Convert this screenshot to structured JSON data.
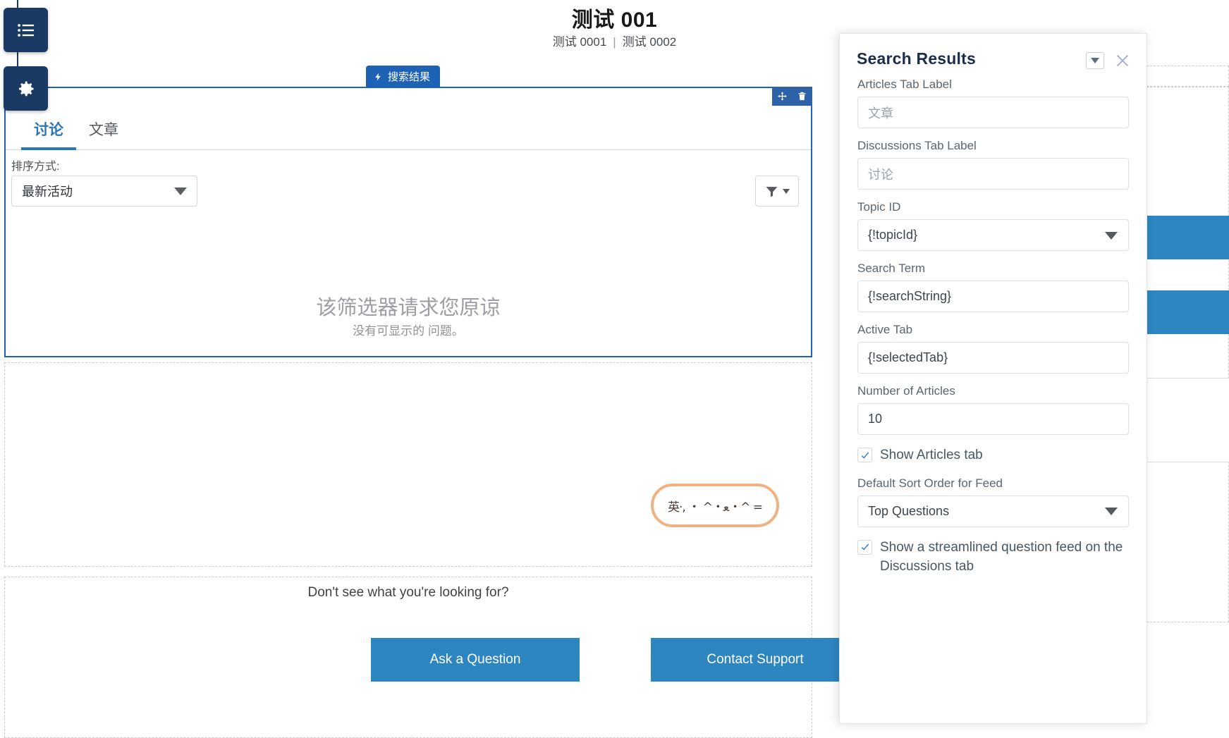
{
  "builder": {
    "rail": {
      "pages_icon": "list-icon",
      "settings_icon": "gear-icon"
    },
    "component_badge": {
      "label": "搜索结果",
      "icon": "lightning-bolt-icon"
    },
    "component_tools": {
      "move_icon": "move-arrows-icon",
      "delete_icon": "trash-icon"
    }
  },
  "page": {
    "title": "测试 001",
    "subtitle_left": "测试 0001",
    "subtitle_sep": "|",
    "subtitle_right": "测试 0002"
  },
  "component": {
    "tabs": [
      {
        "label": "讨论",
        "active": true
      },
      {
        "label": "文章",
        "active": false
      }
    ],
    "sort": {
      "label": "排序方式:",
      "value": "最新活动",
      "caret_icon": "chevron-down-icon"
    },
    "filter": {
      "icon": "funnel-icon",
      "caret_icon": "chevron-down-icon"
    },
    "empty_state": {
      "headline": "该筛选器请求您原谅",
      "subtext": "没有可显示的 问题。"
    },
    "sticker": {
      "text": "英·, ・ ^・ﻌ・^ ="
    }
  },
  "cta": {
    "prompt": "Don't see what you're looking for?",
    "ask_button": "Ask a Question",
    "support_button": "Contact Support"
  },
  "panel": {
    "title": "Search Results",
    "collapse_icon": "chevron-down-icon",
    "close_icon": "close-icon",
    "fields": {
      "articles_tab_label": {
        "label": "Articles Tab Label",
        "placeholder": "文章",
        "value": ""
      },
      "discussions_tab_label": {
        "label": "Discussions Tab Label",
        "placeholder": "讨论",
        "value": ""
      },
      "topic_id": {
        "label": "Topic ID",
        "value": "{!topicId}"
      },
      "search_term": {
        "label": "Search Term",
        "value": "{!searchString}"
      },
      "active_tab": {
        "label": "Active Tab",
        "value": "{!selectedTab}"
      },
      "number_of_articles": {
        "label": "Number of Articles",
        "value": "10"
      },
      "show_articles_tab": {
        "label": "Show Articles tab",
        "checked": true
      },
      "default_sort_order": {
        "label": "Default Sort Order for Feed",
        "value": "Top Questions"
      },
      "streamlined_feed": {
        "label": "Show a streamlined question feed on the Discussions tab",
        "checked": true
      }
    }
  },
  "colors": {
    "accent_blue": "#2e86c1",
    "builder_blue": "#1d62b5",
    "rail_navy": "#1b3a63",
    "panel_title": "#1b2d4f"
  }
}
